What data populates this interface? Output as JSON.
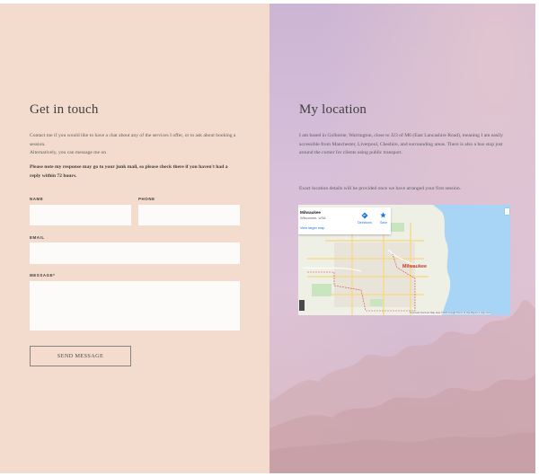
{
  "contact": {
    "title": "Get in touch",
    "intro_1": "Contact me if you would like to have a chat about any of the services I offer, or to ask about booking a session.",
    "intro_2": "Alternatively, you can message me on",
    "note": "Please note my response may go to your junk mail, so please check there if you haven't had a reply within 72 hours.",
    "form": {
      "name_label": "NAME",
      "phone_label": "PHONE",
      "email_label": "EMAIL",
      "message_label": "MESSAGE*",
      "name_value": "",
      "phone_value": "",
      "email_value": "",
      "message_value": "",
      "submit_label": "SEND MESSAGE"
    }
  },
  "location": {
    "title": "My location",
    "text_1": "I am based in Golborne, Warrington, close to J23 of M6 (East Lancashire Road), meaning I am easily accessible from Manchester, Liverpool, Cheshire, and surrounding areas. There is also a bus stop just around the corner for clients using public transport.",
    "text_2": "Exact location details will be provided once we have arranged your first session.",
    "map": {
      "place": "Milwaukee",
      "region": "Wisconsin, USA",
      "directions_label": "Directions",
      "save_label": "Save",
      "view_larger_label": "View larger map",
      "city_label": "Milwaukee",
      "attribution": "Keyboard shortcuts   Map data ©2022 Google   Terms of Use   Report a map error"
    }
  },
  "colors": {
    "left_bg": "#f3dccd",
    "right_bg": "#d6bfd8",
    "field_bg": "#fdfbfa",
    "button_border": "#8a8480"
  }
}
